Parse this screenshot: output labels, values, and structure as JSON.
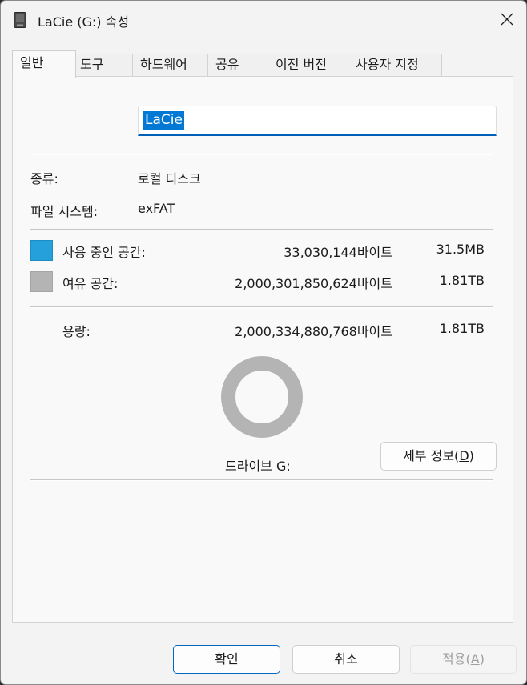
{
  "window": {
    "title": "LaCie (G:) 속성"
  },
  "tabs": [
    {
      "label": "일반"
    },
    {
      "label": "도구"
    },
    {
      "label": "하드웨어"
    },
    {
      "label": "공유"
    },
    {
      "label": "이전 버전"
    },
    {
      "label": "사용자 지정"
    }
  ],
  "general": {
    "volume_name": "LaCie",
    "type_label": "종류:",
    "type_value": "로컬 디스크",
    "fs_label": "파일 시스템:",
    "fs_value": "exFAT",
    "used": {
      "label": "사용 중인 공간:",
      "bytes": "33,030,144바이트",
      "human": "31.5MB",
      "color": "#26a0da",
      "fraction": 1.65e-05
    },
    "free": {
      "label": "여유 공간:",
      "bytes": "2,000,301,850,624바이트",
      "human": "1.81TB",
      "color": "#b4b4b4"
    },
    "capacity": {
      "label": "용량:",
      "bytes": "2,000,334,880,768바이트",
      "human": "1.81TB"
    },
    "drive_label": "드라이브 G:",
    "details_button": {
      "text": "세부 정보(",
      "mnemonic": "D",
      "close": ")"
    }
  },
  "footer": {
    "ok": "확인",
    "cancel": "취소",
    "apply": {
      "text": "적용(",
      "mnemonic": "A",
      "close": ")"
    }
  },
  "icons": {
    "title": "drive-icon",
    "close": "close-icon"
  }
}
